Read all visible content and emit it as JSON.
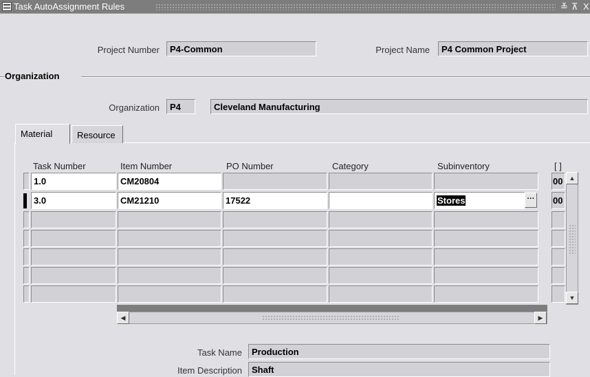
{
  "window": {
    "title": "Task AutoAssignment Rules",
    "minimize_glyph": "≚",
    "maximize_glyph": "⊼",
    "close_glyph": "X"
  },
  "header": {
    "project_number_label": "Project Number",
    "project_number_value": "P4-Common",
    "project_name_label": "Project Name",
    "project_name_value": "P4 Common Project"
  },
  "organization": {
    "section_title": "Organization",
    "label": "Organization",
    "code": "P4",
    "name": "Cleveland Manufacturing"
  },
  "tabs": [
    {
      "label": "Material",
      "active": true
    },
    {
      "label": "Resource",
      "active": false
    }
  ],
  "grid": {
    "columns": [
      "Task Number",
      "Item Number",
      "PO Number",
      "Category",
      "Subinventory",
      "[ ]"
    ],
    "rows": [
      {
        "task": "1.0",
        "item": "CM20804",
        "po": "",
        "category": "",
        "subinventory": "",
        "extra": "00"
      },
      {
        "task": "3.0",
        "item": "CM21210",
        "po": "17522",
        "category": "",
        "subinventory": "Stores",
        "extra": "00"
      }
    ],
    "lov_glyph": "···",
    "scroll_up": "▲",
    "scroll_down": "▼",
    "scroll_left": "◀",
    "scroll_right": "▶"
  },
  "details": {
    "task_name_label": "Task Name",
    "task_name_value": "Production",
    "item_description_label": "Item Description",
    "item_description_value": "Shaft"
  }
}
